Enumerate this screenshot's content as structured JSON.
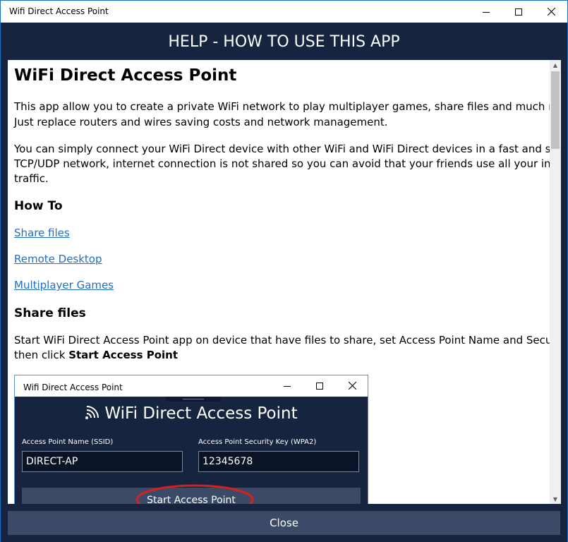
{
  "window": {
    "title": "Wifi Direct Access Point"
  },
  "header": {
    "title": "HELP - HOW TO USE THIS APP"
  },
  "content": {
    "title": "WiFi Direct Access Point",
    "intro_lines": [
      "This app allow you to create a private WiFi network to play multiplayer games, share files and much more.",
      "Just replace routers and wires saving costs and network management."
    ],
    "desc_lines": [
      "You can simply connect your WiFi Direct device with other WiFi and WiFi Direct devices in a fast and safe",
      "TCP/UDP network, internet connection is not shared so you can avoid that your friends use all your internet",
      "traffic."
    ],
    "howto_heading": "How To",
    "links": [
      "Share files",
      "Remote Desktop",
      "Multiplayer Games"
    ],
    "share_heading": "Share files",
    "share_line1": "Start WiFi Direct Access Point app on device that have files to share, set Access Point Name and Security Key",
    "share_line2_prefix": "then click ",
    "share_line2_bold": "Start Access Point"
  },
  "screenshot": {
    "window_title": "Wifi Direct Access Point",
    "app_title": "WiFi Direct Access Point",
    "ssid_label": "Access Point Name (SSID)",
    "ssid_value": "DIRECT-AP",
    "key_label": "Access Point Security Key (WPA2)",
    "key_value": "12345678",
    "start_button": "Start Access Point",
    "highlight_color": "#d42020"
  },
  "footer": {
    "close_label": "Close"
  },
  "colors": {
    "header_bg": "#16243f",
    "button_bg": "#3b4a66",
    "link": "#1f6fc4"
  },
  "scroll": {
    "position_fraction": 0.0
  }
}
